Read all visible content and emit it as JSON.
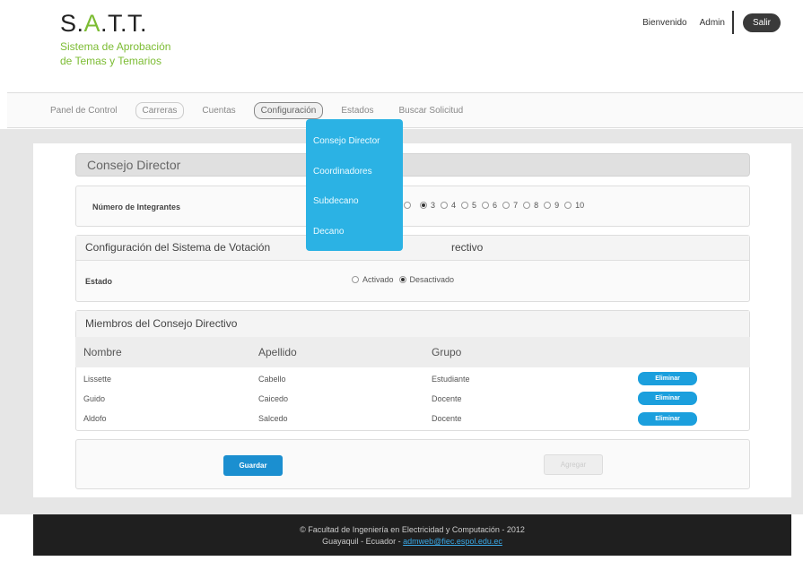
{
  "header": {
    "logo_prefix": "S.",
    "logo_a": "A",
    "logo_suffix": ".T.T.",
    "subtitle_line1": "Sistema de Aprobación",
    "subtitle_line2": "de Temas y Temarios",
    "welcome": "Bienvenido",
    "username": "Admin",
    "logout_label": "Salir"
  },
  "nav": {
    "items": [
      {
        "label": "Panel de Control"
      },
      {
        "label": "Carreras"
      },
      {
        "label": "Cuentas"
      },
      {
        "label": "Configuración"
      },
      {
        "label": "Estados"
      },
      {
        "label": "Buscar Solicitud"
      }
    ]
  },
  "dropdown": {
    "items": [
      {
        "label": "Consejo Director"
      },
      {
        "label": "Coordinadores"
      },
      {
        "label": "Subdecano"
      },
      {
        "label": "Decano"
      }
    ]
  },
  "main": {
    "title": "Consejo Director",
    "members_count": {
      "label": "Número de Integrantes",
      "options": [
        "3",
        "4",
        "5",
        "6",
        "7",
        "8",
        "9",
        "10"
      ],
      "selected": "3"
    },
    "voting": {
      "title": "Configuración del Sistema de Votación",
      "title_tail": "rectivo",
      "state_label": "Estado",
      "options": [
        "Activado",
        "Desactivado"
      ],
      "selected": "Desactivado"
    },
    "members": {
      "title": "Miembros del Consejo Directivo",
      "columns": [
        "Nombre",
        "Apellido",
        "Grupo"
      ],
      "rows": [
        {
          "nombre": "Lissette",
          "apellido": "Cabello",
          "grupo": "Estudiante",
          "action": "Eliminar"
        },
        {
          "nombre": "Guido",
          "apellido": "Caicedo",
          "grupo": "Docente",
          "action": "Eliminar"
        },
        {
          "nombre": "Aldofo",
          "apellido": "Salcedo",
          "grupo": "Docente",
          "action": "Eliminar"
        }
      ]
    },
    "save_label": "Guardar",
    "add_label": "Agregar"
  },
  "footer": {
    "line1": "© Facultad de Ingeniería en Electricidad y Computación - 2012",
    "line2_prefix": "Guayaquil - Ecuador - ",
    "email": "admweb@fiec.espol.edu.ec"
  }
}
